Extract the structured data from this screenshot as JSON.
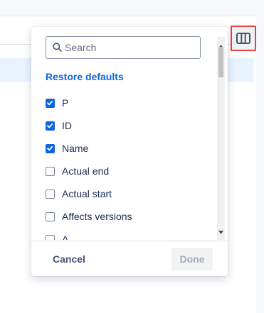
{
  "column_picker": {
    "search": {
      "placeholder": "Search",
      "value": ""
    },
    "restore_defaults_label": "Restore defaults",
    "items": [
      {
        "label": "P",
        "checked": true
      },
      {
        "label": "ID",
        "checked": true
      },
      {
        "label": "Name",
        "checked": true
      },
      {
        "label": "Actual end",
        "checked": false
      },
      {
        "label": "Actual start",
        "checked": false
      },
      {
        "label": "Affects versions",
        "checked": false
      },
      {
        "label": "A",
        "checked": false
      }
    ],
    "cancel_label": "Cancel",
    "done_label": "Done"
  },
  "icons": {
    "columns_toggle": "columns-icon",
    "search": "search-icon",
    "check": "checkmark-icon"
  },
  "colors": {
    "accent": "#0c66e4",
    "highlight_border": "#e34343",
    "text": "#172b4d",
    "disabled_text": "#a5adba"
  }
}
